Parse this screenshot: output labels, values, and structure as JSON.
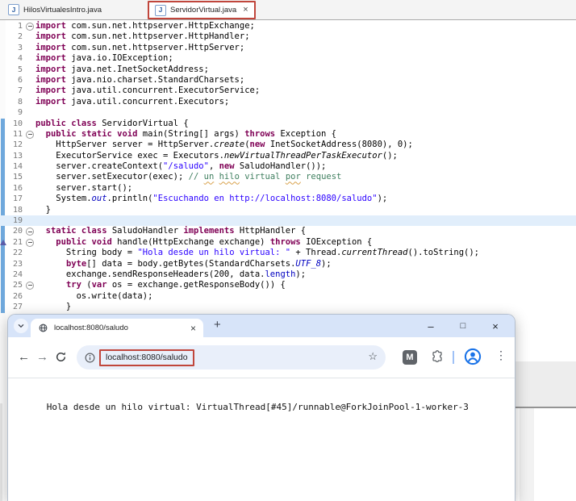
{
  "colors": {
    "annotation_red": "#c0463c",
    "keyword_purple": "#7f0055",
    "string_blue": "#2a00ff",
    "comment_green": "#3f7f5f",
    "field_blue": "#0000c0",
    "diff_bar_blue": "#6fa8dc",
    "chrome_frame_blue": "#d7e4f9",
    "accent_blue": "#1a73e8"
  },
  "glyphs": {
    "java_file": "J",
    "close": "×",
    "new_tab": "+",
    "minimize": "–",
    "maximize": "□",
    "back": "←",
    "forward": "→",
    "star": "☆",
    "kebab": "⋮"
  },
  "editor": {
    "tabs": [
      {
        "label": "HilosVirtualesIntro.java",
        "active": false
      },
      {
        "label": "ServidorVirtual.java",
        "active": true,
        "annotated": true
      }
    ],
    "current_line": 19,
    "changed_lines": {
      "from": 10,
      "to": 27
    },
    "override_marker_line": 21,
    "lines": [
      {
        "n": 1,
        "fold": true,
        "segs": [
          [
            "k",
            "import "
          ],
          [
            "p",
            "com.sun.net.httpserver.HttpExchange;"
          ]
        ]
      },
      {
        "n": 2,
        "segs": [
          [
            "k",
            "import "
          ],
          [
            "p",
            "com.sun.net.httpserver.HttpHandler;"
          ]
        ]
      },
      {
        "n": 3,
        "segs": [
          [
            "k",
            "import "
          ],
          [
            "p",
            "com.sun.net.httpserver.HttpServer;"
          ]
        ]
      },
      {
        "n": 4,
        "segs": [
          [
            "k",
            "import "
          ],
          [
            "p",
            "java.io.IOException;"
          ]
        ]
      },
      {
        "n": 5,
        "segs": [
          [
            "k",
            "import "
          ],
          [
            "p",
            "java.net.InetSocketAddress;"
          ]
        ]
      },
      {
        "n": 6,
        "segs": [
          [
            "k",
            "import "
          ],
          [
            "p",
            "java.nio.charset.StandardCharsets;"
          ]
        ]
      },
      {
        "n": 7,
        "segs": [
          [
            "k",
            "import "
          ],
          [
            "p",
            "java.util.concurrent.ExecutorService;"
          ]
        ]
      },
      {
        "n": 8,
        "segs": [
          [
            "k",
            "import "
          ],
          [
            "p",
            "java.util.concurrent.Executors;"
          ]
        ]
      },
      {
        "n": 9,
        "segs": []
      },
      {
        "n": 10,
        "segs": [
          [
            "k",
            "public class "
          ],
          [
            "p",
            "ServidorVirtual {"
          ]
        ]
      },
      {
        "n": 11,
        "fold": true,
        "segs": [
          [
            "p",
            "  "
          ],
          [
            "k",
            "public static void "
          ],
          [
            "p",
            "main(String[] args) "
          ],
          [
            "k",
            "throws "
          ],
          [
            "p",
            "Exception {"
          ]
        ]
      },
      {
        "n": 12,
        "segs": [
          [
            "p",
            "    HttpServer server = HttpServer."
          ],
          [
            "m",
            "create"
          ],
          [
            "p",
            "("
          ],
          [
            "k",
            "new"
          ],
          [
            "p",
            " InetSocketAddress(8080), 0);"
          ]
        ]
      },
      {
        "n": 13,
        "segs": [
          [
            "p",
            "    ExecutorService exec = Executors."
          ],
          [
            "m",
            "newVirtualThreadPerTaskExecutor"
          ],
          [
            "p",
            "();"
          ]
        ]
      },
      {
        "n": 14,
        "segs": [
          [
            "p",
            "    server.createContext("
          ],
          [
            "s",
            "\"/saludo\""
          ],
          [
            "p",
            ", "
          ],
          [
            "k",
            "new"
          ],
          [
            "p",
            " SaludoHandler());"
          ]
        ]
      },
      {
        "n": 15,
        "segs": [
          [
            "p",
            "    server.setExecutor(exec); "
          ],
          [
            "c",
            "// "
          ],
          [
            "w",
            "un"
          ],
          [
            "c",
            " "
          ],
          [
            "w",
            "hilo"
          ],
          [
            "c",
            " virtual "
          ],
          [
            "w",
            "por"
          ],
          [
            "c",
            " request"
          ]
        ]
      },
      {
        "n": 16,
        "segs": [
          [
            "p",
            "    server.start();"
          ]
        ]
      },
      {
        "n": 17,
        "segs": [
          [
            "p",
            "    System."
          ],
          [
            "i",
            "out"
          ],
          [
            "p",
            ".println("
          ],
          [
            "s",
            "\"Escuchando en http://localhost:8080/saludo\""
          ],
          [
            "p",
            ");"
          ]
        ]
      },
      {
        "n": 18,
        "segs": [
          [
            "p",
            "  }"
          ]
        ]
      },
      {
        "n": 19,
        "segs": []
      },
      {
        "n": 20,
        "fold": true,
        "segs": [
          [
            "p",
            "  "
          ],
          [
            "k",
            "static class "
          ],
          [
            "p",
            "SaludoHandler "
          ],
          [
            "k",
            "implements "
          ],
          [
            "p",
            "HttpHandler {"
          ]
        ]
      },
      {
        "n": 21,
        "fold": true,
        "segs": [
          [
            "p",
            "    "
          ],
          [
            "k",
            "public void "
          ],
          [
            "p",
            "handle(HttpExchange exchange) "
          ],
          [
            "k",
            "throws "
          ],
          [
            "p",
            "IOException {"
          ]
        ]
      },
      {
        "n": 22,
        "segs": [
          [
            "p",
            "      String body = "
          ],
          [
            "s",
            "\"Hola desde un hilo virtual: \""
          ],
          [
            "p",
            " + Thread."
          ],
          [
            "m",
            "currentThread"
          ],
          [
            "p",
            "().toString();"
          ]
        ]
      },
      {
        "n": 23,
        "segs": [
          [
            "p",
            "      "
          ],
          [
            "k",
            "byte"
          ],
          [
            "p",
            "[] data = body.getBytes(StandardCharsets."
          ],
          [
            "i",
            "UTF_8"
          ],
          [
            "p",
            ");"
          ]
        ]
      },
      {
        "n": 24,
        "segs": [
          [
            "p",
            "      exchange.sendResponseHeaders(200, data."
          ],
          [
            "f",
            "length"
          ],
          [
            "p",
            ");"
          ]
        ]
      },
      {
        "n": 25,
        "fold": true,
        "segs": [
          [
            "p",
            "      "
          ],
          [
            "k",
            "try"
          ],
          [
            "p",
            " ("
          ],
          [
            "k",
            "var"
          ],
          [
            "p",
            " os = exchange.getResponseBody()) {"
          ]
        ]
      },
      {
        "n": 26,
        "segs": [
          [
            "p",
            "        os.write(data);"
          ]
        ]
      },
      {
        "n": 27,
        "segs": [
          [
            "p",
            "      }"
          ]
        ]
      }
    ]
  },
  "browser": {
    "tab_title": "localhost:8080/saludo",
    "url": "localhost:8080/saludo",
    "url_annotated": true,
    "page_text": "Hola desde un hilo virtual: VirtualThread[#45]/runnable@ForkJoinPool-1-worker-3",
    "toolbar": {
      "extension_badge": "M"
    }
  }
}
